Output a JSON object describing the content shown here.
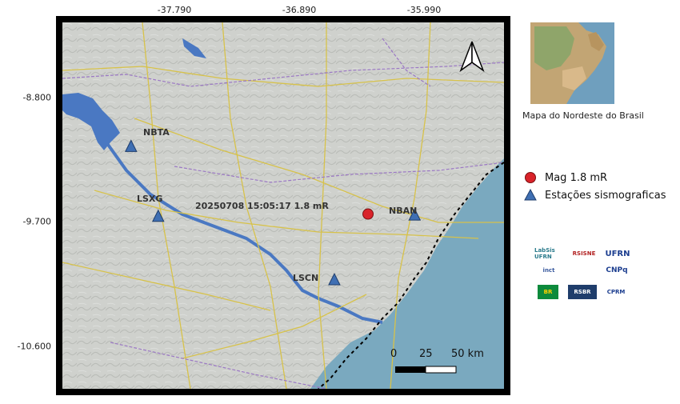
{
  "map": {
    "x_ticks": [
      "-37.790",
      "-36.890",
      "-35.990"
    ],
    "y_ticks": [
      "-8.800",
      "-9.700",
      "-10.600"
    ],
    "stations": [
      {
        "name": "NBTA",
        "lon": -38.46,
        "lat": -9.14
      },
      {
        "name": "LSXG",
        "lon": -38.25,
        "lat": -9.68
      },
      {
        "name": "NBAN",
        "lon": -36.27,
        "lat": -9.67
      },
      {
        "name": "LSCN",
        "lon": -36.89,
        "lat": -10.17
      }
    ],
    "event": {
      "label": "20250708 15:05:17 1.8 mR",
      "lon": -36.63,
      "lat": -9.66
    },
    "scale_bar": {
      "labels": [
        "0",
        "25",
        "50 km"
      ]
    },
    "colors": {
      "sea": "#7aa9bf",
      "land": "#cfd1cd",
      "river": "#4a78c2",
      "station": "#3f6fb3",
      "event": "#d9232a"
    }
  },
  "inset": {
    "caption": "Mapa do  Nordeste do Brasil"
  },
  "legend": {
    "event_label": "Mag 1.8 mR",
    "station_label": "Estações sismograficas"
  },
  "logos": [
    "LabSis UFRN",
    "RSISNE",
    "UFRN",
    "inct",
    "CNPq",
    "BR",
    "RSBR",
    "CPRM"
  ]
}
